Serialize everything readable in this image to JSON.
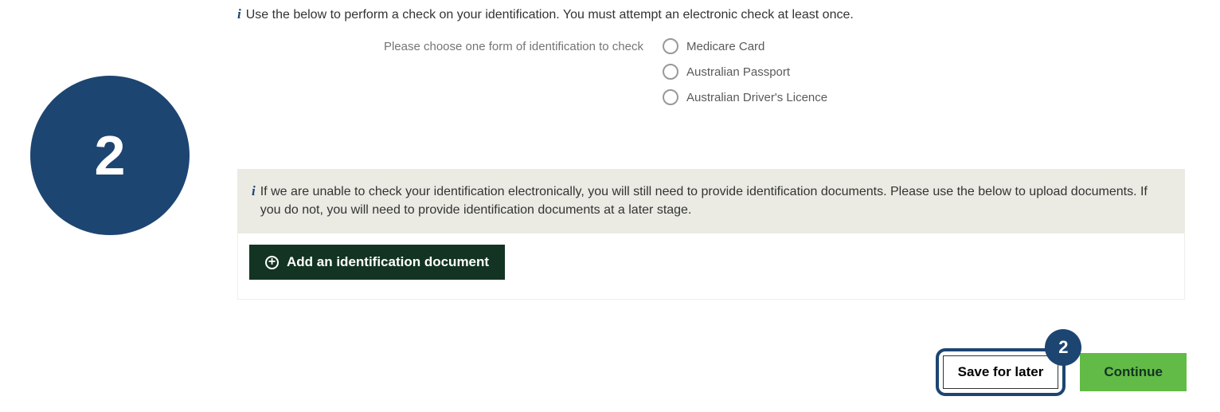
{
  "step_number": "2",
  "info1": "Use the below to perform a check on your identification. You must attempt an electronic check at least once.",
  "radio_lead": "Please choose one form of identification to check",
  "options": [
    "Medicare Card",
    "Australian Passport",
    "Australian Driver's Licence"
  ],
  "info2": "If we are unable to check your identification electronically, you will still need to provide identification documents. Please use the below to upload documents. If you do not, you will need to provide identification documents at a later stage.",
  "add_doc_label": "Add an identification document",
  "save_badge": "2",
  "save_label": "Save for later",
  "continue_label": "Continue"
}
